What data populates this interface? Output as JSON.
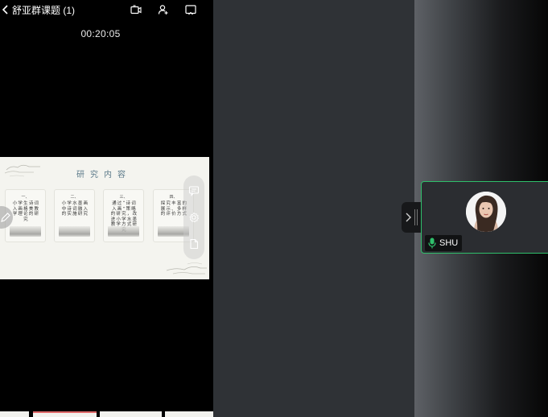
{
  "header": {
    "title": "舒亚群课题 (1)"
  },
  "timer": "00:20:05",
  "slide": {
    "title": "研究内容",
    "cards": [
      {
        "num": "一、",
        "text": "小学生诗词入画格美教学理论的研究"
      },
      {
        "num": "二、",
        "text": "小学水墨画中诗词融入的实施研究"
      },
      {
        "num": "三、",
        "text": "通过“诗词入画”策略的研究，改进小学水墨教学方式研究"
      },
      {
        "num": "四、",
        "text": "探究丰富的展示、多样的评价方式"
      }
    ]
  },
  "participant": {
    "name": "SHU"
  },
  "colors": {
    "active_border": "#2fbf6b",
    "mic": "#2fbf6b",
    "middle_bg": "#2f3236"
  },
  "icons": [
    "back-icon",
    "camera-switch-icon",
    "add-person-icon",
    "cast-icon",
    "chat-icon",
    "settings-icon",
    "document-icon",
    "pencil-icon",
    "chevron-right-icon",
    "mic-icon",
    "avatar"
  ]
}
